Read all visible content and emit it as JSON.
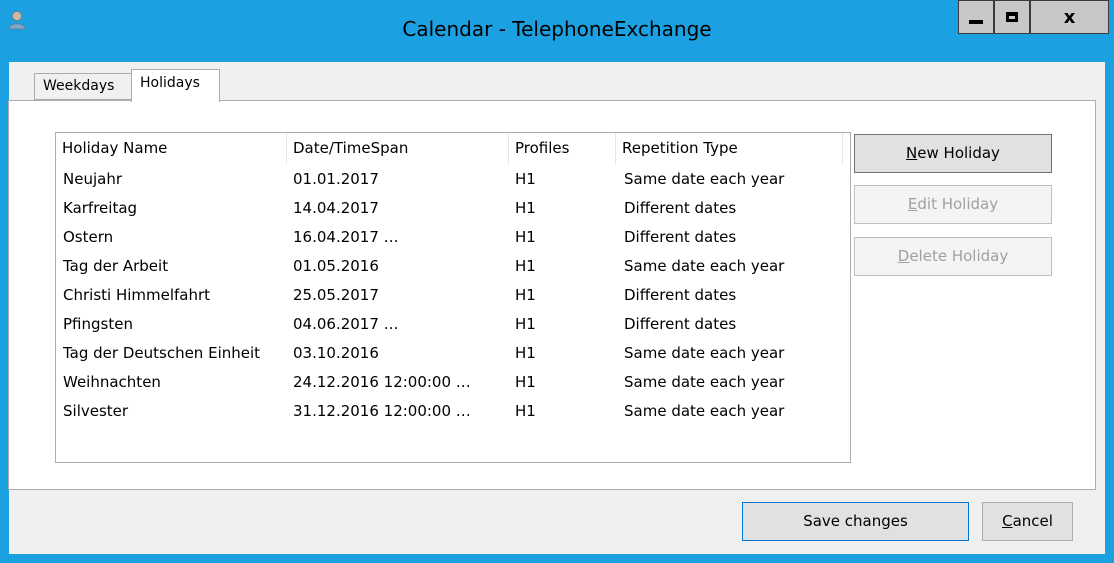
{
  "window": {
    "title": "Calendar - TelephoneExchange",
    "minimize_icon": "minimize-icon",
    "maximize_icon": "maximize-icon",
    "close_label": "x"
  },
  "tabs": [
    {
      "label": "Weekdays",
      "selected": false
    },
    {
      "label": "Holidays",
      "selected": true
    }
  ],
  "table": {
    "columns": [
      "Holiday Name",
      "Date/TimeSpan",
      "Profiles",
      "Repetition Type"
    ],
    "rows": [
      {
        "name": "Neujahr",
        "date": "01.01.2017",
        "profile": "H1",
        "repetition": "Same date each year"
      },
      {
        "name": "Karfreitag",
        "date": "14.04.2017",
        "profile": "H1",
        "repetition": "Different dates"
      },
      {
        "name": "Ostern",
        "date": "16.04.2017 …",
        "profile": "H1",
        "repetition": "Different dates"
      },
      {
        "name": "Tag der Arbeit",
        "date": "01.05.2016",
        "profile": "H1",
        "repetition": "Same date each year"
      },
      {
        "name": "Christi Himmelfahrt",
        "date": "25.05.2017",
        "profile": "H1",
        "repetition": "Different dates"
      },
      {
        "name": "Pfingsten",
        "date": "04.06.2017 …",
        "profile": "H1",
        "repetition": "Different dates"
      },
      {
        "name": "Tag der Deutschen Einheit",
        "date": "03.10.2016",
        "profile": "H1",
        "repetition": "Same date each year"
      },
      {
        "name": "Weihnachten",
        "date": "24.12.2016 12:00:00 …",
        "profile": "H1",
        "repetition": "Same date each year"
      },
      {
        "name": "Silvester",
        "date": "31.12.2016 12:00:00 …",
        "profile": "H1",
        "repetition": "Same date each year"
      }
    ]
  },
  "buttons": {
    "new_holiday": {
      "mnemonic": "N",
      "rest": "ew Holiday"
    },
    "edit_holiday": {
      "mnemonic": "E",
      "rest": "dit Holiday"
    },
    "delete_holiday": {
      "mnemonic": "D",
      "rest": "elete Holiday"
    },
    "save_changes": "Save changes",
    "cancel": {
      "mnemonic": "C",
      "rest": "ancel"
    }
  },
  "colors": {
    "titlebar": "#1ba1e2",
    "client": "#f0f0f0"
  }
}
